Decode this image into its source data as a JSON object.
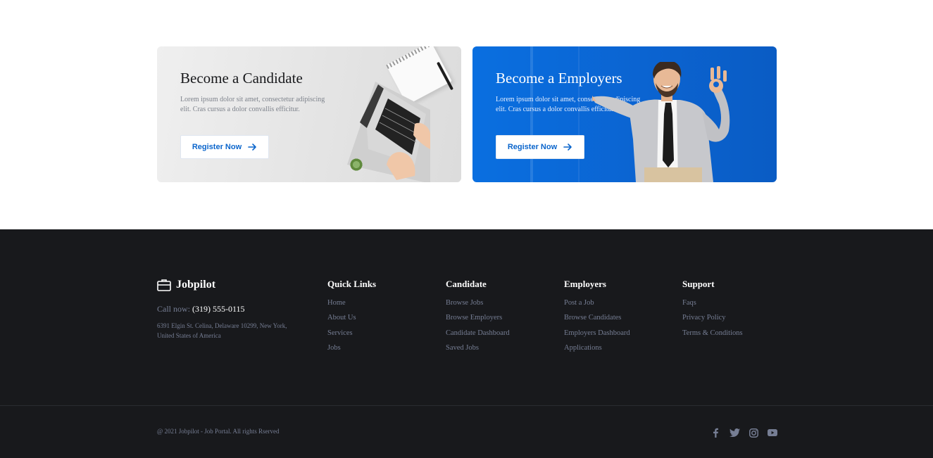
{
  "cards": {
    "candidate": {
      "title": "Become a Candidate",
      "text": "Lorem ipsum dolor sit amet, consectetur adipiscing elit. Cras cursus a dolor convallis efficitur.",
      "button_label": "Register Now"
    },
    "employer": {
      "title": "Become a Employers",
      "text": "Lorem ipsum dolor sit amet, consectetur adipiscing elit. Cras cursus a dolor convallis efficitur.",
      "button_label": "Register Now"
    }
  },
  "footer": {
    "brand": "Jobpilot",
    "call_label": "Call now:",
    "call_number": "(319) 555-0115",
    "address": "6391 Elgin St. Celina, Delaware 10299, New York, United States of America",
    "columns": [
      {
        "heading": "Quick Links",
        "links": [
          "Home",
          "About Us",
          "Services",
          "Jobs"
        ]
      },
      {
        "heading": "Candidate",
        "links": [
          "Browse Jobs",
          "Browse Employers",
          "Candidate Dashboard",
          "Saved Jobs"
        ]
      },
      {
        "heading": "Employers",
        "links": [
          "Post a Job",
          "Browse Candidates",
          "Employers Dashboard",
          "Applications"
        ]
      },
      {
        "heading": "Support",
        "links": [
          "Faqs",
          "Privacy Policy",
          "Terms & Conditions"
        ]
      }
    ],
    "copyright": "@ 2021 Jobpilot - Job Portal. All rights Rserved",
    "social_icons": [
      "facebook-icon",
      "twitter-icon",
      "instagram-icon",
      "youtube-icon"
    ]
  },
  "colors": {
    "primary": "#0a65cc",
    "footer_bg": "#18191c",
    "muted_text": "#767e94"
  }
}
